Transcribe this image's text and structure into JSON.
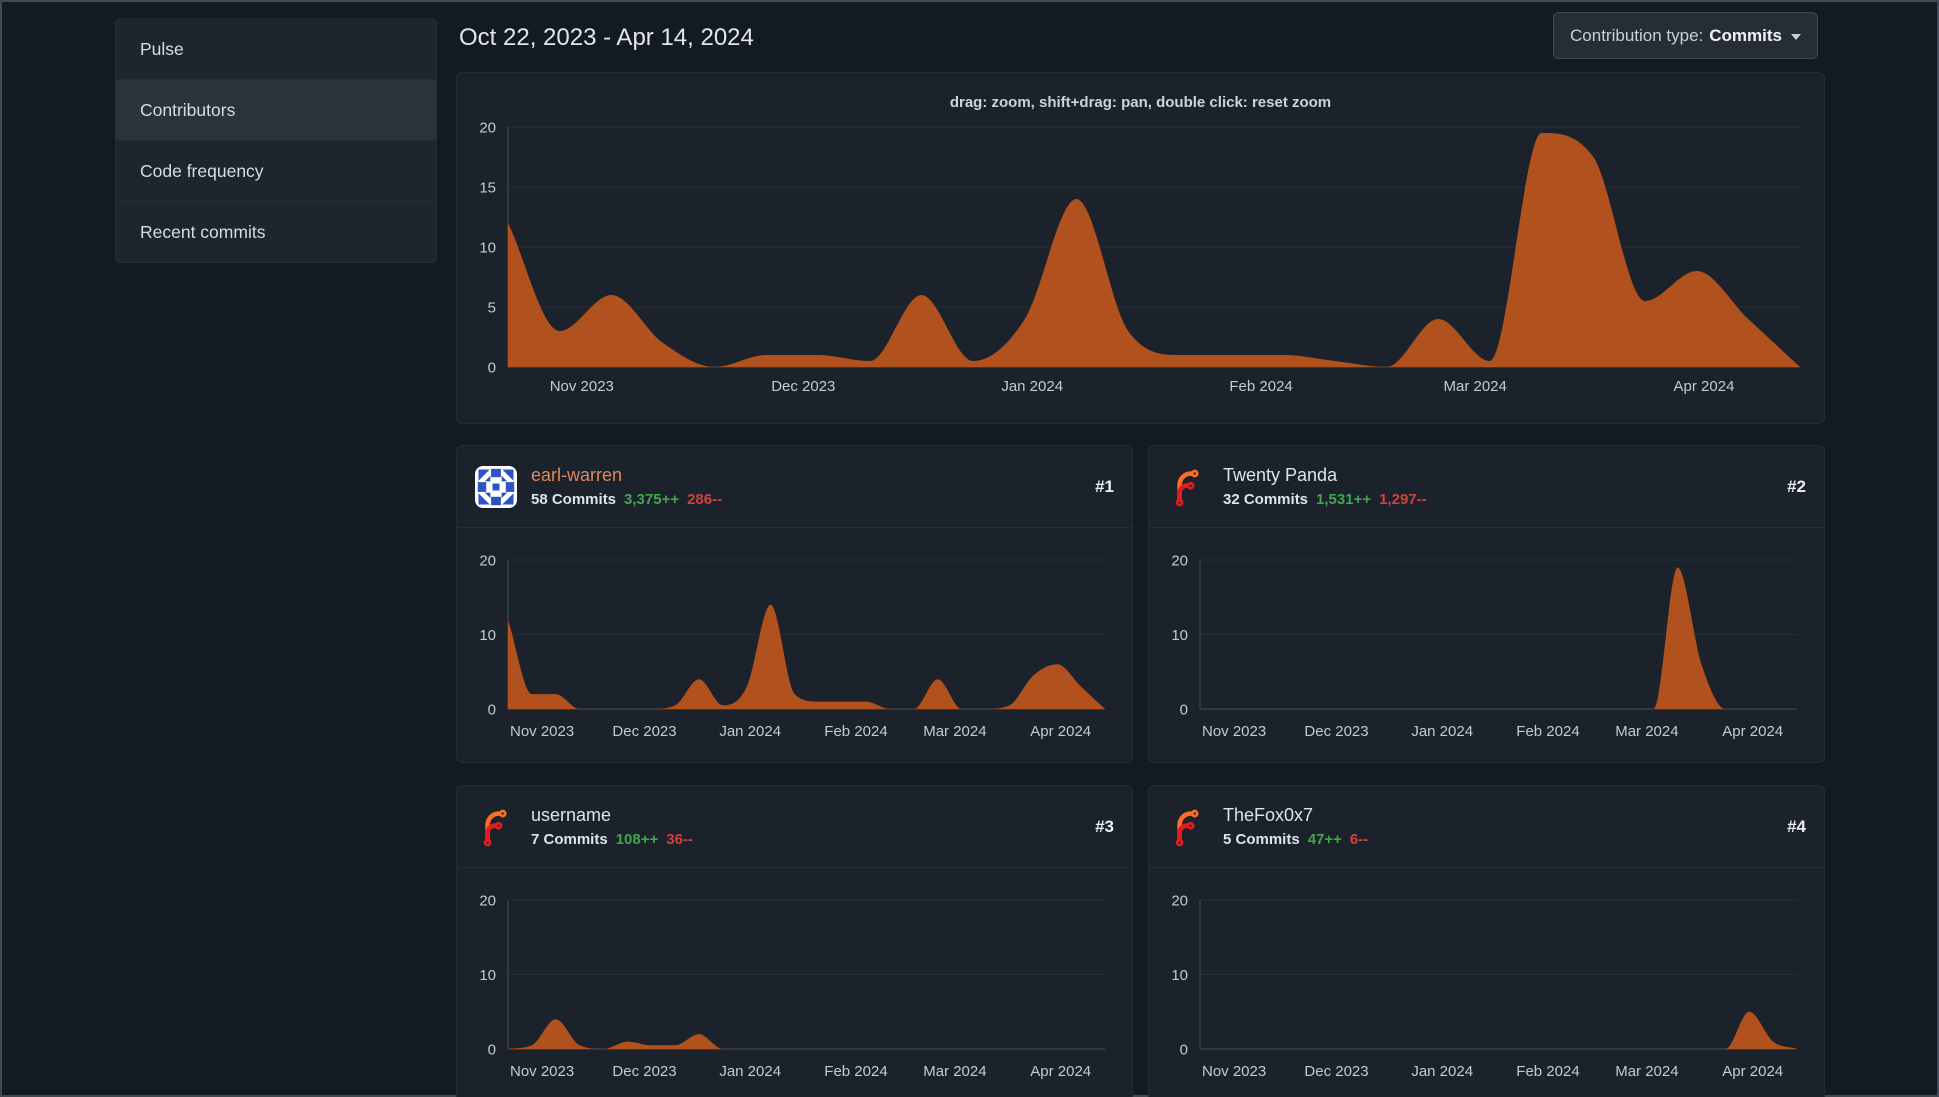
{
  "colors": {
    "page_bg": "#141a22",
    "card_bg": "#1b222b",
    "menu_bg": "#1e252e",
    "menu_selected_bg": "#2b323c",
    "text_primary": "#d6dce2",
    "text_muted": "#c3cad2",
    "chart_fill": "#b1511e",
    "link_orange": "#e0885a",
    "additions_green": "#41a64d",
    "deletions_red": "#d2413a",
    "grid_line": "#272e36",
    "axis_line": "#454d56"
  },
  "sidebar": {
    "items": [
      {
        "label": "Pulse",
        "active": false
      },
      {
        "label": "Contributors",
        "active": true
      },
      {
        "label": "Code frequency",
        "active": false
      },
      {
        "label": "Recent commits",
        "active": false
      }
    ]
  },
  "header": {
    "date_range": "Oct 22, 2023 - Apr 14, 2024"
  },
  "toolbar": {
    "contribution_type_label": "Contribution type:",
    "contribution_type_value": "Commits"
  },
  "contributors": [
    {
      "rank": "#1",
      "name": "earl-warren",
      "commits": "58 Commits",
      "additions": "3,375++",
      "deletions": "286--",
      "avatar": "identicon-blue"
    },
    {
      "rank": "#2",
      "name": "Twenty Panda",
      "commits": "32 Commits",
      "additions": "1,531++",
      "deletions": "1,297--",
      "avatar": "forgejo-logo"
    },
    {
      "rank": "#3",
      "name": "username",
      "commits": "7 Commits",
      "additions": "108++",
      "deletions": "36--",
      "avatar": "forgejo-logo"
    },
    {
      "rank": "#4",
      "name": "TheFox0x7",
      "commits": "5 Commits",
      "additions": "47++",
      "deletions": "6--",
      "avatar": "forgejo-logo"
    }
  ],
  "chart_common": {
    "xticks": [
      "Nov 2023",
      "Dec 2023",
      "Jan 2024",
      "Feb 2024",
      "Mar 2024",
      "Apr 2024"
    ],
    "month_tick_days": [
      10,
      40,
      71,
      102,
      131,
      162
    ],
    "total_days": 175,
    "week_starts": [
      "2023-10-22",
      "2023-10-29",
      "2023-11-05",
      "2023-11-12",
      "2023-11-19",
      "2023-11-26",
      "2023-12-03",
      "2023-12-10",
      "2023-12-17",
      "2023-12-24",
      "2023-12-31",
      "2024-01-07",
      "2024-01-14",
      "2024-01-21",
      "2024-01-28",
      "2024-02-04",
      "2024-02-11",
      "2024-02-18",
      "2024-02-25",
      "2024-03-03",
      "2024-03-10",
      "2024-03-17",
      "2024-03-24",
      "2024-03-31",
      "2024-04-07",
      "2024-04-14"
    ]
  },
  "chart_data": [
    {
      "id": "overall-commits",
      "type": "area",
      "title": "drag: zoom, shift+drag: pan, double click: reset zoom",
      "series_name": "Commits",
      "ylim": [
        0,
        20
      ],
      "yticks": [
        0,
        5,
        10,
        15,
        20
      ],
      "values": [
        12,
        3,
        6,
        2,
        0,
        1,
        1,
        0.5,
        6,
        0.5,
        4,
        14,
        3,
        1,
        1,
        1,
        0.5,
        0,
        4,
        0.5,
        19.5,
        17.5,
        5.5,
        8,
        4,
        0
      ]
    },
    {
      "id": "earl-warren",
      "type": "area",
      "series_name": "Commits",
      "ylim": [
        0,
        20
      ],
      "yticks": [
        0,
        10,
        20
      ],
      "values": [
        12,
        2,
        2,
        0,
        0,
        0,
        0,
        0.5,
        4,
        0.5,
        3,
        14,
        2,
        1,
        1,
        1,
        0,
        0,
        4,
        0,
        0,
        0.5,
        4.5,
        6,
        3,
        0
      ]
    },
    {
      "id": "twenty-panda",
      "type": "area",
      "series_name": "Commits",
      "ylim": [
        0,
        20
      ],
      "yticks": [
        0,
        10,
        20
      ],
      "values": [
        0,
        0,
        0,
        0,
        0,
        0,
        0,
        0,
        0,
        0,
        0,
        0,
        0,
        0,
        0,
        0,
        0,
        0,
        0,
        0,
        19,
        6,
        0,
        0,
        0,
        0
      ]
    },
    {
      "id": "username",
      "type": "area",
      "series_name": "Commits",
      "ylim": [
        0,
        20
      ],
      "yticks": [
        0,
        10,
        20
      ],
      "values": [
        0,
        0.5,
        4,
        0.5,
        0,
        1,
        0.5,
        0.5,
        2,
        0,
        0,
        0,
        0,
        0,
        0,
        0,
        0,
        0,
        0,
        0,
        0,
        0,
        0,
        0,
        0,
        0
      ]
    },
    {
      "id": "thefox0x7",
      "type": "area",
      "series_name": "Commits",
      "ylim": [
        0,
        20
      ],
      "yticks": [
        0,
        10,
        20
      ],
      "values": [
        0,
        0,
        0,
        0,
        0,
        0,
        0,
        0,
        0,
        0,
        0,
        0,
        0,
        0,
        0,
        0,
        0,
        0,
        0,
        0,
        0,
        0,
        0,
        5,
        1,
        0
      ]
    }
  ]
}
